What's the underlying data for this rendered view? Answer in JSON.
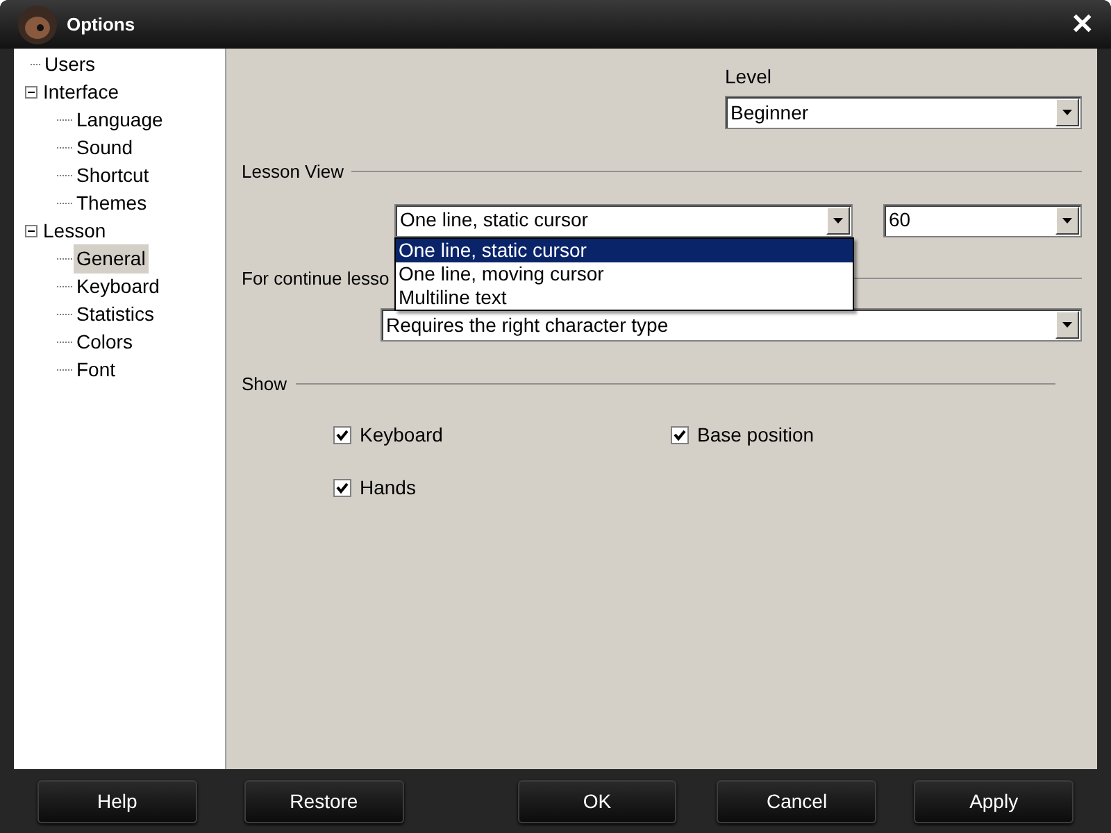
{
  "window": {
    "title": "Options",
    "close": "✕"
  },
  "tree": [
    {
      "label": "Users",
      "selected": false
    },
    {
      "label": "Interface",
      "expanded": true,
      "selected": false,
      "children": [
        {
          "label": "Language",
          "selected": false
        },
        {
          "label": "Sound",
          "selected": false
        },
        {
          "label": "Shortcut",
          "selected": false
        },
        {
          "label": "Themes",
          "selected": false
        }
      ]
    },
    {
      "label": "Lesson",
      "expanded": true,
      "selected": false,
      "children": [
        {
          "label": "General",
          "selected": true
        },
        {
          "label": "Keyboard",
          "selected": false
        },
        {
          "label": "Statistics",
          "selected": false
        },
        {
          "label": "Colors",
          "selected": false
        },
        {
          "label": "Font",
          "selected": false
        }
      ]
    }
  ],
  "level": {
    "label": "Level",
    "value": "Beginner"
  },
  "lesson_view": {
    "heading": "Lesson View",
    "view": "One line, static cursor",
    "speed": "60",
    "dropdown_open": true,
    "options": [
      {
        "label": "One line, static cursor",
        "selected": true
      },
      {
        "label": "One line, moving cursor",
        "selected": false
      },
      {
        "label": "Multiline text",
        "selected": false
      }
    ]
  },
  "continue": {
    "heading": "For continue lesso",
    "value": "Requires the right character type"
  },
  "show": {
    "heading": "Show",
    "checkboxes": [
      {
        "label": "Keyboard",
        "checked": true
      },
      {
        "label": "Base position",
        "checked": true
      },
      {
        "label": "Hands",
        "checked": true
      }
    ]
  },
  "buttons": [
    "Help",
    "Restore",
    "OK",
    "Cancel",
    "Apply"
  ]
}
